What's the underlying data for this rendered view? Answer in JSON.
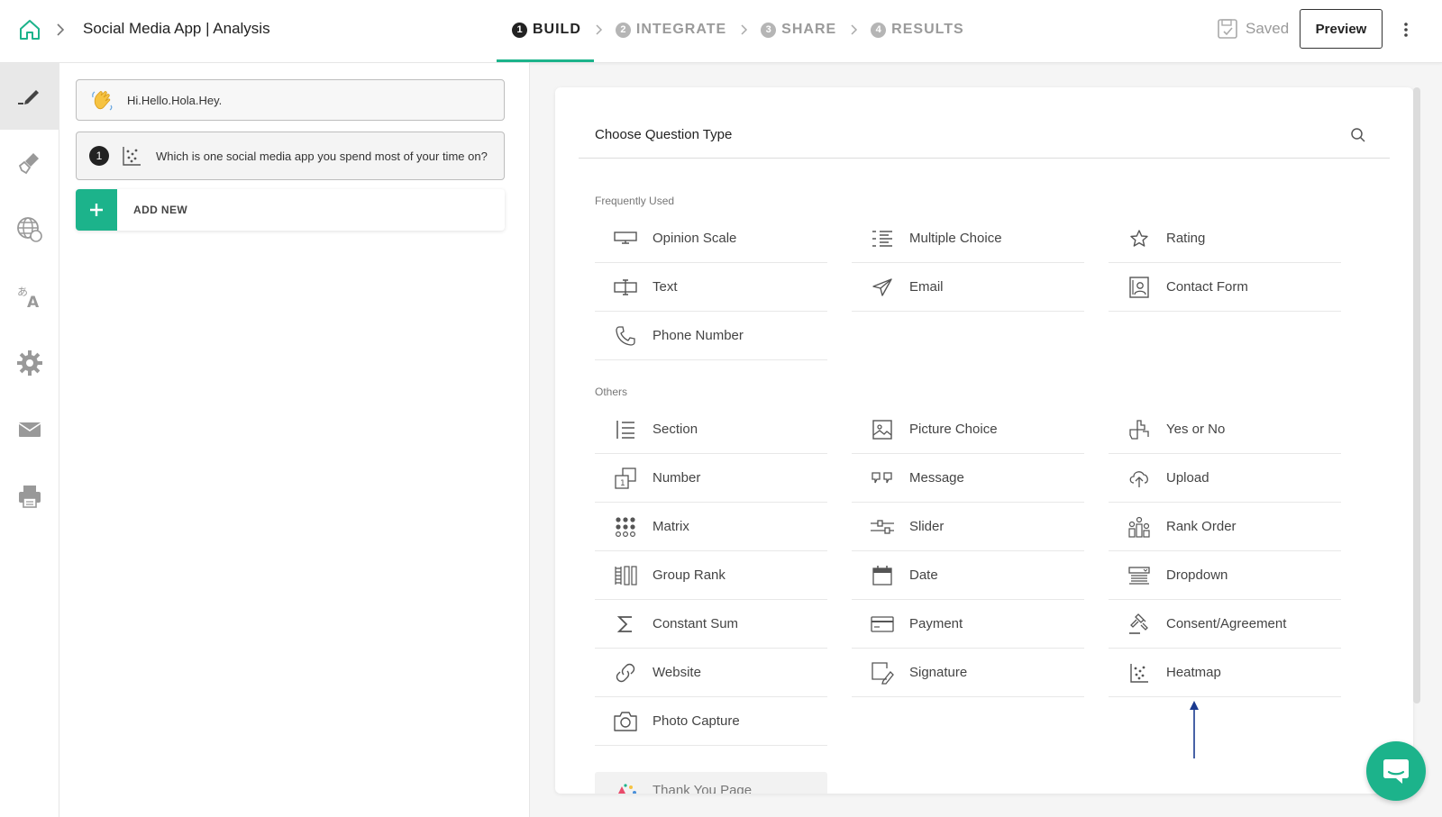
{
  "header": {
    "app_title": "Social Media App | Analysis",
    "steps": [
      {
        "num": "1",
        "label": "BUILD"
      },
      {
        "num": "2",
        "label": "INTEGRATE"
      },
      {
        "num": "3",
        "label": "SHARE"
      },
      {
        "num": "4",
        "label": "RESULTS"
      }
    ],
    "active_step": "BUILD",
    "saved_label": "Saved",
    "preview_label": "Preview"
  },
  "rail": {
    "items": [
      "pencil-icon",
      "paint-brush-icon",
      "globe-icon",
      "translate-icon",
      "gear-icon",
      "mail-icon",
      "printer-icon"
    ]
  },
  "questions": {
    "welcome_text": "Hi.Hello.Hola.Hey.",
    "items": [
      {
        "num": "1",
        "text": "Which is one social media app you spend most of your time on?"
      }
    ],
    "add_new_label": "ADD NEW"
  },
  "chooser": {
    "title": "Choose Question Type",
    "frequent_label": "Frequently Used",
    "others_label": "Others",
    "frequent": [
      {
        "label": "Opinion Scale",
        "icon": "opinion-scale-icon"
      },
      {
        "label": "Multiple Choice",
        "icon": "multiple-choice-icon"
      },
      {
        "label": "Rating",
        "icon": "star-icon"
      },
      {
        "label": "Text",
        "icon": "text-icon"
      },
      {
        "label": "Email",
        "icon": "paper-plane-icon"
      },
      {
        "label": "Contact Form",
        "icon": "contact-form-icon"
      },
      {
        "label": "Phone Number",
        "icon": "phone-icon"
      }
    ],
    "others": [
      {
        "label": "Section",
        "icon": "section-icon"
      },
      {
        "label": "Picture Choice",
        "icon": "picture-icon"
      },
      {
        "label": "Yes or No",
        "icon": "yes-no-icon"
      },
      {
        "label": "Number",
        "icon": "number-icon"
      },
      {
        "label": "Message",
        "icon": "quote-icon"
      },
      {
        "label": "Upload",
        "icon": "cloud-upload-icon"
      },
      {
        "label": "Matrix",
        "icon": "matrix-icon"
      },
      {
        "label": "Slider",
        "icon": "slider-icon"
      },
      {
        "label": "Rank Order",
        "icon": "rank-order-icon"
      },
      {
        "label": "Group Rank",
        "icon": "group-rank-icon"
      },
      {
        "label": "Date",
        "icon": "calendar-icon"
      },
      {
        "label": "Dropdown",
        "icon": "dropdown-icon"
      },
      {
        "label": "Constant Sum",
        "icon": "sigma-icon"
      },
      {
        "label": "Payment",
        "icon": "credit-card-icon"
      },
      {
        "label": "Consent/Agreement",
        "icon": "gavel-icon"
      },
      {
        "label": "Website",
        "icon": "link-icon"
      },
      {
        "label": "Signature",
        "icon": "signature-icon"
      },
      {
        "label": "Heatmap",
        "icon": "heatmap-icon"
      },
      {
        "label": "Photo Capture",
        "icon": "camera-icon"
      }
    ],
    "thank_you_label": "Thank You Page"
  },
  "colors": {
    "accent": "#1cb38b",
    "arrow": "#1a3a8f"
  }
}
